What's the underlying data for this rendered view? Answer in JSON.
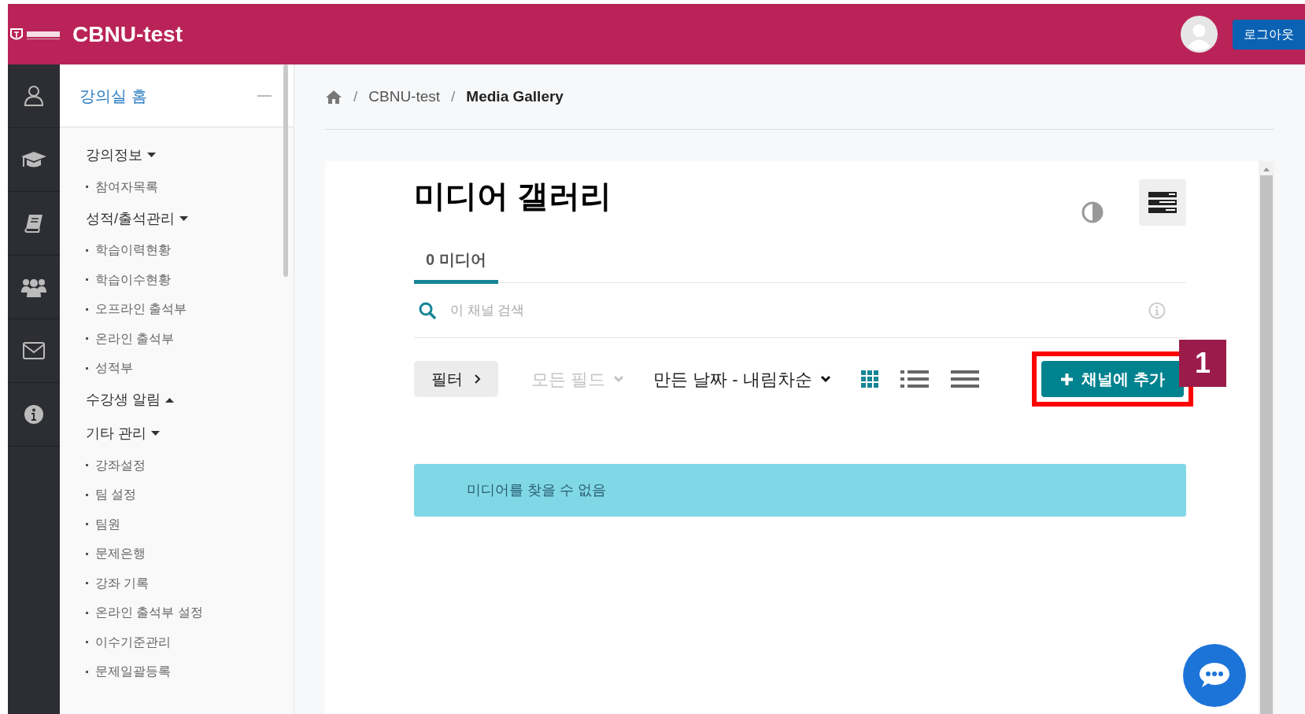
{
  "header": {
    "title": "CBNU-test",
    "logout": "로그아웃"
  },
  "sidebar": {
    "home": "강의실 홈",
    "sections": [
      {
        "label": "강의정보",
        "expanded": true,
        "items": [
          "참여자목록"
        ]
      },
      {
        "label": "성적/출석관리",
        "expanded": true,
        "items": [
          "학습이력현황",
          "학습이수현황",
          "오프라인 출석부",
          "온라인 출석부",
          "성적부"
        ]
      },
      {
        "label": "수강생 알림",
        "expanded": false
      },
      {
        "label": "기타 관리",
        "expanded": true,
        "items": [
          "강좌설정",
          "팀 설정",
          "팀원",
          "문제은행",
          "강좌 기록",
          "온라인 출석부 설정",
          "이수기준관리",
          "문제일괄등록"
        ]
      }
    ]
  },
  "breadcrumb": [
    {
      "separator": "/",
      "label": "CBNU-test"
    },
    {
      "separator": "/",
      "label": "Media Gallery"
    }
  ],
  "page_title": "미디어 갤러리",
  "tabs": [
    {
      "label": "0 미디어",
      "selected": true
    }
  ],
  "search": {
    "placeholder": "이 채널 검색"
  },
  "toolbar": {
    "filter": "필터",
    "field": {
      "label": "모든 필드",
      "disabled": true
    },
    "sort": "만든 날짜 - 내림차순",
    "views": [
      {
        "kind": "grid",
        "selected": true
      },
      {
        "kind": "list",
        "selected": false
      },
      {
        "kind": "compact",
        "selected": false
      }
    ],
    "add_button": "채널에 추가"
  },
  "annotation": "1",
  "alert": "미디어를 찾을 수 없음"
}
